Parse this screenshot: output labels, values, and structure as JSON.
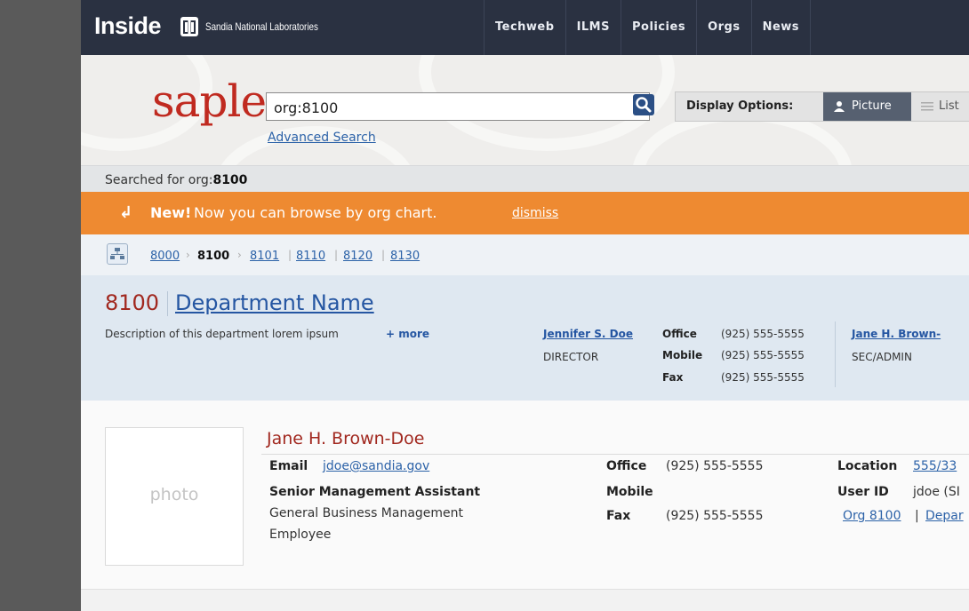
{
  "topbar": {
    "brand": "Inside",
    "org_name": "Sandia National Laboratories",
    "nav": [
      "Techweb",
      "ILMS",
      "Policies",
      "Orgs",
      "News"
    ]
  },
  "search": {
    "logo": "saple",
    "query": "org:8100",
    "advanced_link": "Advanced Search",
    "display_options_label": "Display Options:",
    "option_picture": "Picture",
    "option_list": "List"
  },
  "searched_for": {
    "prefix": "Searched for",
    "key": "org:",
    "value": "8100"
  },
  "banner": {
    "new_label": "New!",
    "message": "Now you can browse by org chart.",
    "dismiss": "dismiss"
  },
  "breadcrumbs": [
    "8000",
    "8100",
    "8101",
    "8110",
    "8120",
    "8130"
  ],
  "department": {
    "number": "8100",
    "name": "Department Name",
    "description": "Description of this department lorem ipsum",
    "more_link": "+ more",
    "contacts": [
      {
        "name": "Jennifer S. Doe",
        "role": "DIRECTOR",
        "office_label": "Office",
        "office": "(925) 555-5555",
        "mobile_label": "Mobile",
        "mobile": "(925) 555-5555",
        "fax_label": "Fax",
        "fax": "(925) 555-5555"
      },
      {
        "name": "Jane H. Brown-",
        "role": "SEC/ADMIN"
      }
    ]
  },
  "person": {
    "photo_placeholder": "photo",
    "name": "Jane H. Brown-Doe",
    "email_label": "Email",
    "email": "jdoe@sandia.gov",
    "title": "Senior Management Assistant",
    "group": "General Business Management",
    "type": "Employee",
    "office_label": "Office",
    "office": "(925) 555-5555",
    "mobile_label": "Mobile",
    "fax_label": "Fax",
    "fax": "(925) 555-5555",
    "location_label": "Location",
    "location": "555/33",
    "userid_label": "User ID",
    "userid": "jdoe (SI",
    "org_link": "Org 8100",
    "separator": "|",
    "dept_link": "Depar"
  },
  "colors": {
    "topbar": "#2a3141",
    "accent_red": "#a1281f",
    "banner_orange": "#ee8a31",
    "link_blue": "#2c62a8"
  }
}
